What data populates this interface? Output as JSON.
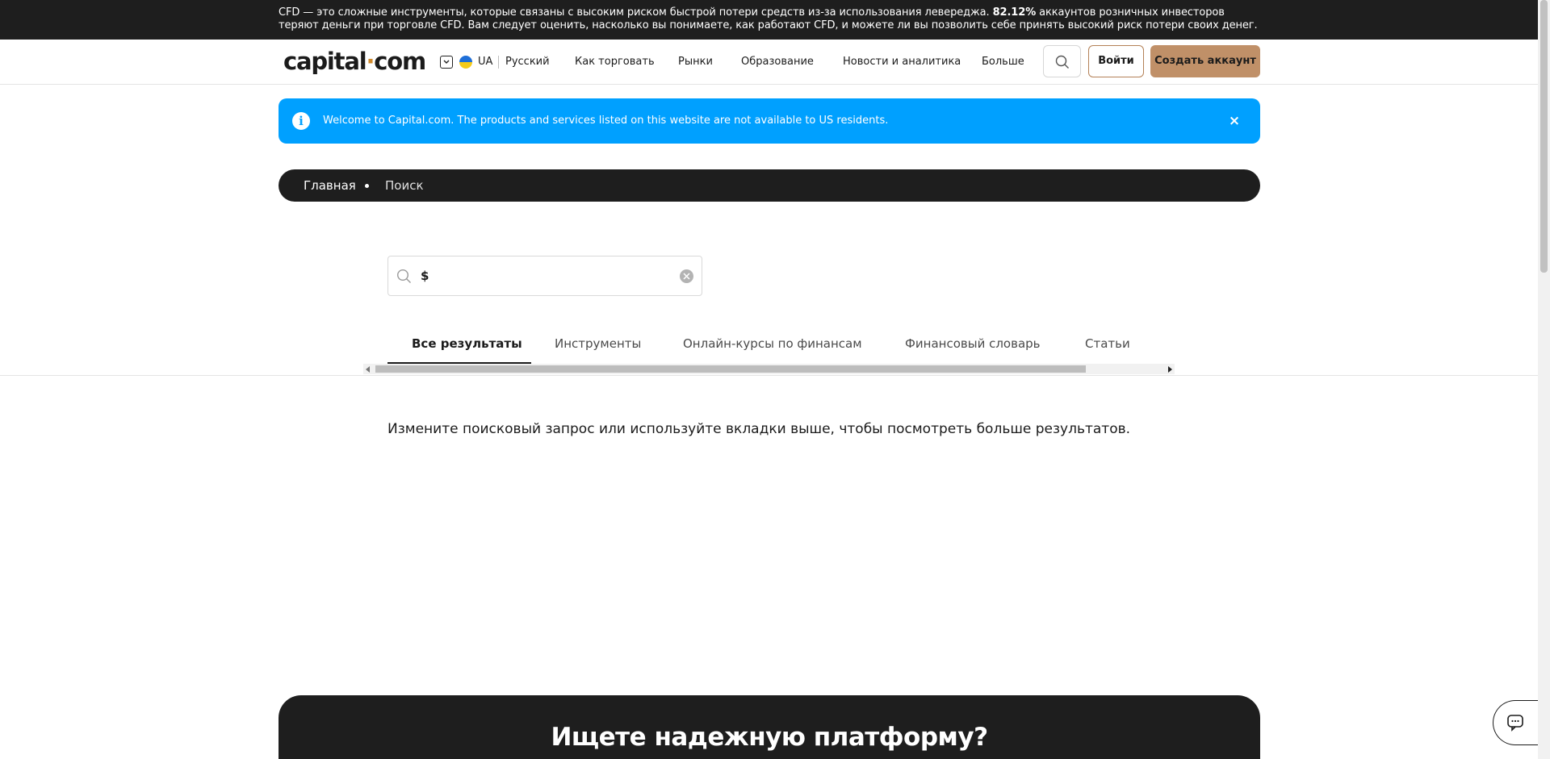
{
  "risk_warning": {
    "text_before": "CFD — это сложные инструменты, которые связаны с высоким риском быстрой потери средств из-за использования левереджа.",
    "percent": "82.12%",
    "text_after": "аккаунтов розничных инвесторов теряют деньги при торговле CFD. Вам следует оценить, насколько вы понимаете, как работают CFD, и можете ли вы позволить себе принять высокий риск потери своих денег."
  },
  "header": {
    "logo_left": "capital",
    "logo_dot": "·",
    "logo_right": "com",
    "language_code": "UA",
    "language_name": "Русский",
    "nav": [
      "Как торговать",
      "Рынки",
      "Образование",
      "Новости и аналитика",
      "Больше"
    ],
    "login_label": "Войти",
    "signup_label": "Создать аккаунт"
  },
  "notice": {
    "icon": "info-icon",
    "text": "Welcome to Capital.com. The products and services listed on this website are not available to US residents.",
    "close": "×"
  },
  "breadcrumb": {
    "home": "Главная",
    "current": "Поиск"
  },
  "search": {
    "value": "$",
    "placeholder": ""
  },
  "tabs": [
    {
      "label": "Все результаты",
      "active": true
    },
    {
      "label": "Инструменты",
      "active": false
    },
    {
      "label": "Онлайн-курсы по финансам",
      "active": false
    },
    {
      "label": "Финансовый словарь",
      "active": false
    },
    {
      "label": "Статьи",
      "active": false
    }
  ],
  "results": {
    "empty_message": "Измените поисковый запрос или используйте вкладки выше, чтобы посмотреть больше результатов."
  },
  "cta": {
    "title": "Ищете надежную платформу?"
  },
  "colors": {
    "dark": "#1e1e1e",
    "notice_blue": "#00a0ff",
    "accent_brown": "#c09068",
    "logo_dot": "#d08a2c"
  }
}
